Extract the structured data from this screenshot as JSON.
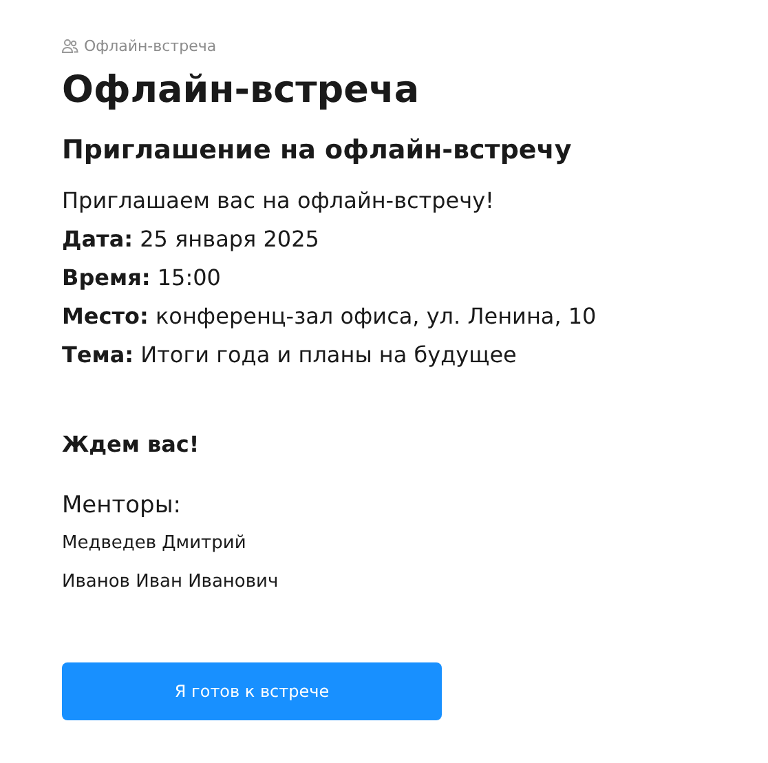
{
  "breadcrumb": {
    "label": "Офлайн-встреча"
  },
  "title": "Офлайн-встреча",
  "invitation": {
    "heading": "Приглашение на офлайн-встречу",
    "lead": "Приглашаем вас на офлайн-встречу!",
    "details": [
      {
        "text": "**Дата:** 25 января 2025"
      },
      {
        "text": "**Время:** 15:00"
      },
      {
        "text": "**Место:** конференц-зал офиса, ул. Ленина, 10"
      },
      {
        "text": "**Тема:** Итоги года и планы на будущее"
      }
    ],
    "closing": "Ждем вас!"
  },
  "mentors": {
    "heading": "Менторы:",
    "names": [
      "Медведев Дмитрий",
      "Иванов Иван Иванович"
    ]
  },
  "button": {
    "label": "Я готов к встрече"
  }
}
